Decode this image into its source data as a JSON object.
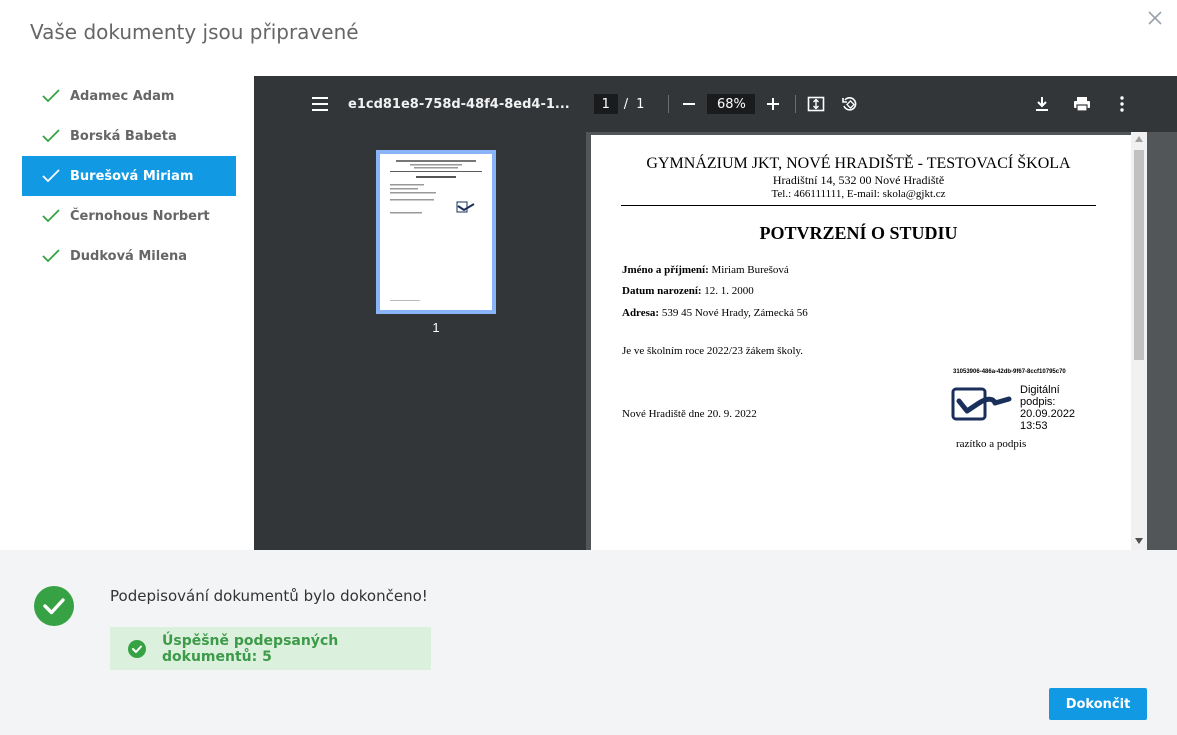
{
  "dialog": {
    "title": "Vaše dokumenty jsou připravené"
  },
  "students": [
    {
      "name": "Adamec Adam"
    },
    {
      "name": "Borská Babeta"
    },
    {
      "name": "Burešová Miriam"
    },
    {
      "name": "Černohous Norbert"
    },
    {
      "name": "Dudková Milena"
    }
  ],
  "viewer": {
    "doc_name": "e1cd81e8-758d-48f4-8ed4-1...",
    "page_current": "1",
    "page_sep": "/",
    "page_total": "1",
    "zoom": "68%",
    "thumb_number": "1"
  },
  "document": {
    "school": "GYMNÁZIUM JKT, NOVÉ HRADIŠTĚ - TESTOVACÍ ŠKOLA",
    "address": "Hradištní 14, 532 00 Nové Hradiště",
    "contact": "Tel.: 466111111, E-mail: skola@gjkt.cz",
    "heading": "POTVRZENÍ O STUDIU",
    "name_label": "Jméno a příjmení:",
    "name_value": "Miriam Burešová",
    "dob_label": "Datum narození:",
    "dob_value": "12. 1. 2000",
    "addr_label": "Adresa:",
    "addr_value": "539 45 Nové Hrady, Zámecká 56",
    "statement": "Je ve školním roce 2022/23 žákem školy.",
    "sig_id": "31053906-486a-42db-9f67-8ccf10795c70",
    "sig_line1": "Digitální",
    "sig_line2": "podpis:",
    "sig_date": "20.09.2022",
    "sig_time": "13:53",
    "place_date": "Nové Hradiště dne 20. 9. 2022",
    "stamp": "razítko a podpis"
  },
  "footer": {
    "done_message": "Podepisování dokumentů bylo dokončeno!",
    "success_message": "Úspěšně podepsaných dokumentů: 5",
    "finish_label": "Dokončit"
  },
  "colors": {
    "accent": "#119ae3",
    "success": "#37a244",
    "success_bg": "#dbf1de"
  }
}
